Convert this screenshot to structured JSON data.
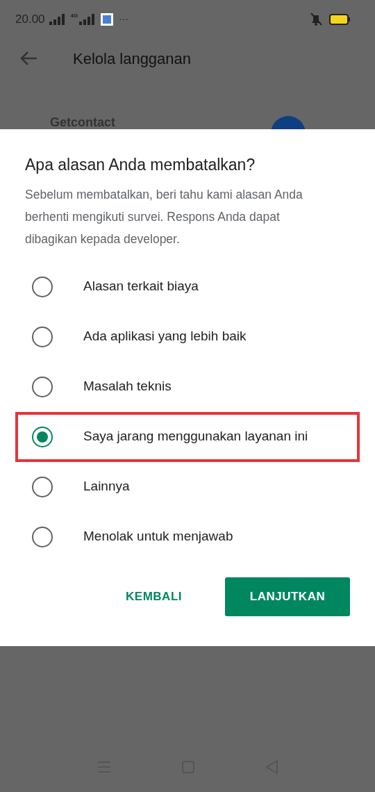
{
  "status_bar": {
    "time": "20.00",
    "network": "4G",
    "more": "···"
  },
  "app_bar": {
    "title": "Kelola langganan"
  },
  "background_item": {
    "title": "Getcontact"
  },
  "dialog": {
    "title": "Apa alasan Anda membatalkan?",
    "description": "Sebelum membatalkan, beri tahu kami alasan Anda berhenti mengikuti survei. Respons Anda dapat dibagikan kepada developer.",
    "options": [
      {
        "label": "Alasan terkait biaya",
        "selected": false,
        "highlighted": false
      },
      {
        "label": "Ada aplikasi yang lebih baik",
        "selected": false,
        "highlighted": false
      },
      {
        "label": "Masalah teknis",
        "selected": false,
        "highlighted": false
      },
      {
        "label": "Saya jarang menggunakan layanan ini",
        "selected": true,
        "highlighted": true
      },
      {
        "label": "Lainnya",
        "selected": false,
        "highlighted": false
      },
      {
        "label": "Menolak untuk menjawab",
        "selected": false,
        "highlighted": false
      }
    ],
    "buttons": [
      {
        "label": "KEMBALI",
        "kind": "text"
      },
      {
        "label": "LANJUTKAN",
        "kind": "filled"
      }
    ]
  }
}
